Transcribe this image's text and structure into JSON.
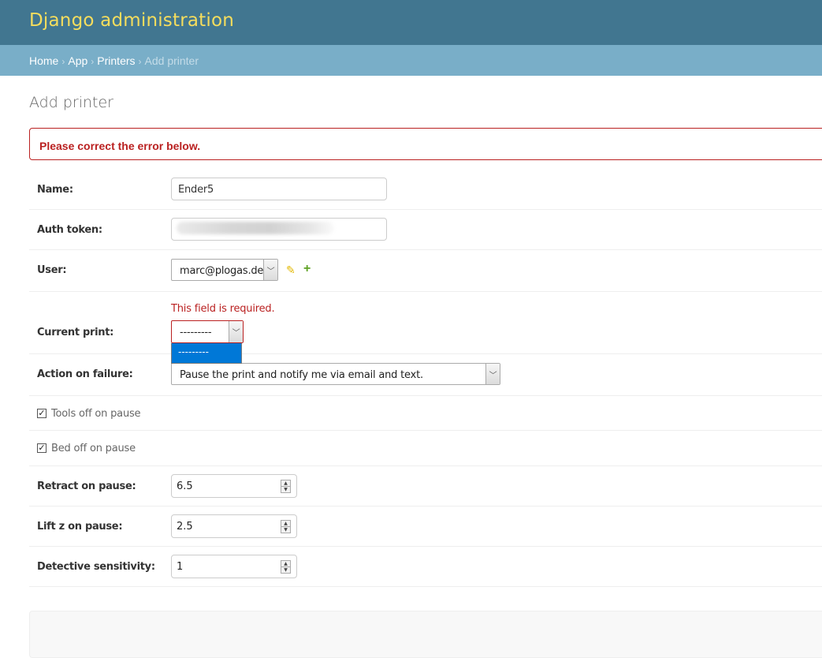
{
  "header": {
    "title": "Django administration"
  },
  "breadcrumbs": {
    "home": "Home",
    "app": "App",
    "printers": "Printers",
    "current": "Add printer",
    "separator": "›"
  },
  "page": {
    "title": "Add printer"
  },
  "errornote": "Please correct the error below.",
  "form": {
    "name": {
      "label": "Name:",
      "value": "Ender5"
    },
    "auth_token": {
      "label": "Auth token:",
      "value": ""
    },
    "user": {
      "label": "User:",
      "value": "marc@plogas.de",
      "edit_icon": "pencil-icon",
      "add_icon": "plus-icon"
    },
    "current_print": {
      "label": "Current print:",
      "value": "---------",
      "error": "This field is required.",
      "dropdown_option": "---------"
    },
    "action_on_failure": {
      "label": "Action on failure:",
      "value": "Pause the print and notify me via email and text."
    },
    "tools_off_on_pause": {
      "label": "Tools off on pause",
      "checked": true
    },
    "bed_off_on_pause": {
      "label": "Bed off on pause",
      "checked": true
    },
    "retract_on_pause": {
      "label": "Retract on pause:",
      "value": "6.5"
    },
    "lift_z_on_pause": {
      "label": "Lift z on pause:",
      "value": "2.5"
    },
    "detective_sensitivity": {
      "label": "Detective sensitivity:",
      "value": "1"
    }
  },
  "colors": {
    "header_bg": "#417690",
    "branding": "#f5dd5d",
    "breadcrumbs_bg": "#79aec8",
    "error": "#ba2121",
    "dropdown_highlight": "#0078d7"
  }
}
